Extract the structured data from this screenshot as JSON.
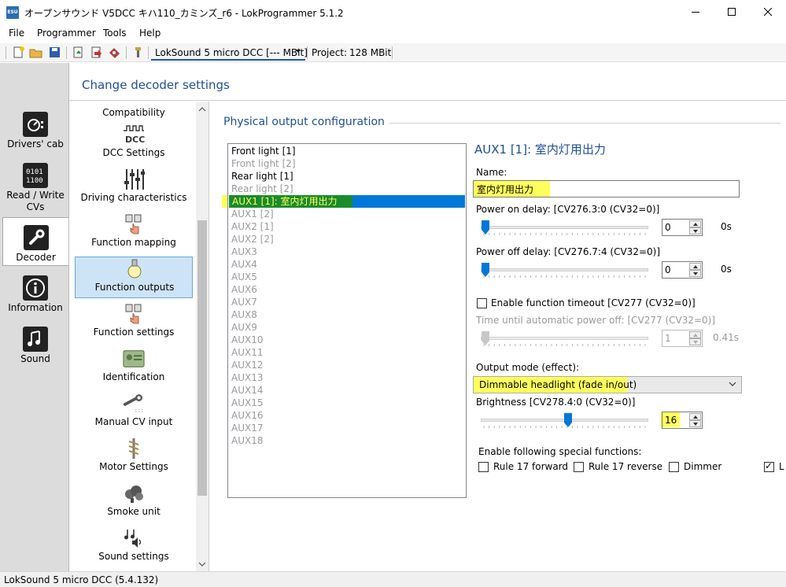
{
  "window": {
    "icon_text": "ESU",
    "title": "オープンサウンド V5DCC キハ110_カミンズ_r6 - LokProgrammer 5.1.2"
  },
  "menu": [
    "File",
    "Programmer",
    "Tools",
    "Help"
  ],
  "toolbar": {
    "decoder": "LokSound 5 micro DCC [--- MBit]",
    "project_label": "Project:",
    "project_value": "128 MBit"
  },
  "leftnav": [
    {
      "label": "Drivers' cab",
      "icon": "drivers-cab-icon"
    },
    {
      "label": "Read / Write CVs",
      "icon": "read-write-cvs-icon"
    },
    {
      "label": "Decoder",
      "icon": "decoder-wrench-icon",
      "selected": true
    },
    {
      "label": "Information",
      "icon": "information-icon"
    },
    {
      "label": "Sound",
      "icon": "sound-notes-icon"
    }
  ],
  "header": {
    "title": "Change decoder settings"
  },
  "categories": [
    {
      "label": "Compatibility"
    },
    {
      "label": "DCC Settings"
    },
    {
      "label": "Driving characteristics"
    },
    {
      "label": "Function mapping"
    },
    {
      "label": "Function outputs",
      "selected": true
    },
    {
      "label": "Function settings"
    },
    {
      "label": "Identification"
    },
    {
      "label": "Manual CV input"
    },
    {
      "label": "Motor Settings"
    },
    {
      "label": "Smoke unit"
    },
    {
      "label": "Sound settings"
    }
  ],
  "section": {
    "title": "Physical output configuration"
  },
  "outputs": [
    {
      "label": "Front light [1]",
      "active": true
    },
    {
      "label": "Front light [2]",
      "active": false
    },
    {
      "label": "Rear light [1]",
      "active": true
    },
    {
      "label": "Rear light [2]",
      "active": false
    },
    {
      "label": "AUX1 [1]: 室内灯用出力",
      "active": true,
      "selected": true
    },
    {
      "label": "AUX1 [2]",
      "active": false
    },
    {
      "label": "AUX2 [1]",
      "active": false
    },
    {
      "label": "AUX2 [2]",
      "active": false
    },
    {
      "label": "AUX3",
      "active": false
    },
    {
      "label": "AUX4",
      "active": false
    },
    {
      "label": "AUX5",
      "active": false
    },
    {
      "label": "AUX6",
      "active": false
    },
    {
      "label": "AUX7",
      "active": false
    },
    {
      "label": "AUX8",
      "active": false
    },
    {
      "label": "AUX9",
      "active": false
    },
    {
      "label": "AUX10",
      "active": false
    },
    {
      "label": "AUX11",
      "active": false
    },
    {
      "label": "AUX12",
      "active": false
    },
    {
      "label": "AUX13",
      "active": false
    },
    {
      "label": "AUX14",
      "active": false
    },
    {
      "label": "AUX15",
      "active": false
    },
    {
      "label": "AUX16",
      "active": false
    },
    {
      "label": "AUX17",
      "active": false
    },
    {
      "label": "AUX18",
      "active": false
    }
  ],
  "detail": {
    "title": "AUX1 [1]: 室内灯用出力",
    "name_label": "Name:",
    "name_value": "室内灯用出力",
    "power_on_label": "Power on delay: [CV276.3:0 (CV32=0)]",
    "power_on_value": "0",
    "power_on_unit": "0s",
    "power_off_label": "Power off delay: [CV276.7:4 (CV32=0)]",
    "power_off_value": "0",
    "power_off_unit": "0s",
    "timeout_label": "Enable function timeout [CV277 (CV32=0)]",
    "timeout_checked": false,
    "auto_off_label": "Time until automatic power off: [CV277 (CV32=0)]",
    "auto_off_value": "1",
    "auto_off_unit": "0.41s",
    "mode_label": "Output mode (effect):",
    "mode_value": "Dimmable headlight (fade in/out)",
    "brightness_label": "Brightness [CV278.4:0 (CV32=0)]",
    "brightness_value": "16",
    "brightness_level": 16,
    "brightness_max": 31,
    "special_label": "Enable following special functions:",
    "specials": [
      {
        "label": "Rule 17 forward",
        "checked": false
      },
      {
        "label": "Rule 17 reverse",
        "checked": false
      },
      {
        "label": "Dimmer",
        "checked": false
      },
      {
        "label": "L",
        "checked": true
      }
    ]
  },
  "status": {
    "text": "LokSound 5 micro DCC (5.4.132)"
  },
  "colors": {
    "accent_blue": "#1f4e99",
    "selection_blue": "#0078d7",
    "highlight_yellow": "#ffff5c",
    "highlight_green": "#1a8b2c"
  }
}
